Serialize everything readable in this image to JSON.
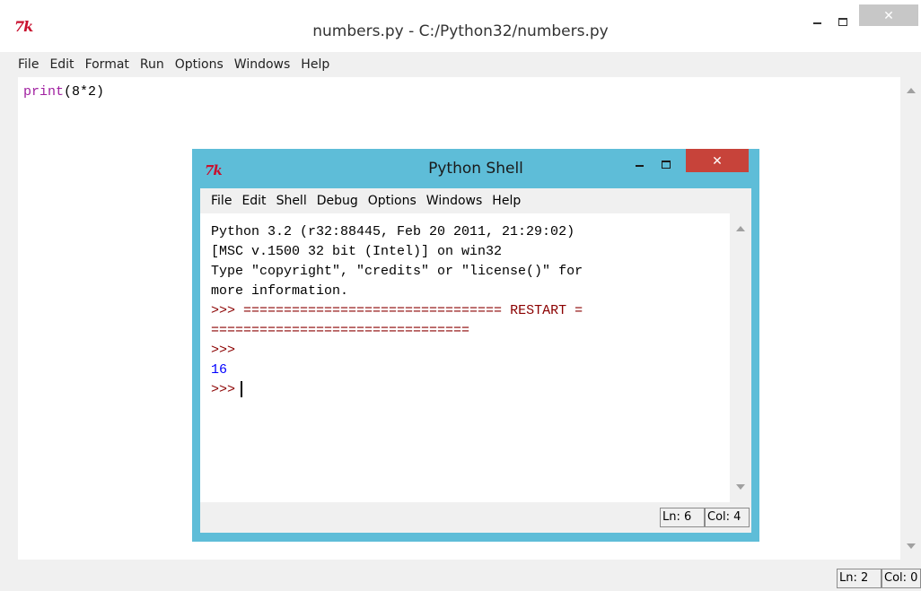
{
  "main_window": {
    "title": "numbers.py - C:/Python32/numbers.py",
    "logo_text": "7k",
    "menu": [
      "File",
      "Edit",
      "Format",
      "Run",
      "Options",
      "Windows",
      "Help"
    ],
    "code": {
      "keyword": "print",
      "rest": "(8*2)"
    },
    "status": {
      "ln": "Ln: 2",
      "col": "Col: 0"
    },
    "close_glyph": "✕"
  },
  "shell_window": {
    "title": "Python Shell",
    "logo_text": "7k",
    "menu": [
      "File",
      "Edit",
      "Shell",
      "Debug",
      "Options",
      "Windows",
      "Help"
    ],
    "lines": {
      "l1": "Python 3.2 (r32:88445, Feb 20 2011, 21:29:02)",
      "l2": "[MSC v.1500 32 bit (Intel)] on win32",
      "l3": "Type \"copyright\", \"credits\" or \"license()\" for",
      "l4": "more information.",
      "l5_prompt": ">>> ",
      "l5_rest": "================================ RESTART =",
      "l6": "================================",
      "l7_prompt": ">>>",
      "l8_output": "16",
      "l9_prompt": ">>>"
    },
    "status": {
      "ln": "Ln: 6",
      "col": "Col: 4"
    },
    "close_glyph": "✕"
  },
  "colors": {
    "shell_frame": "#5ebdd8",
    "shell_close": "#c7433a",
    "keyword": "#a020a0",
    "prompt": "#8b0000",
    "output": "#0000ff"
  }
}
